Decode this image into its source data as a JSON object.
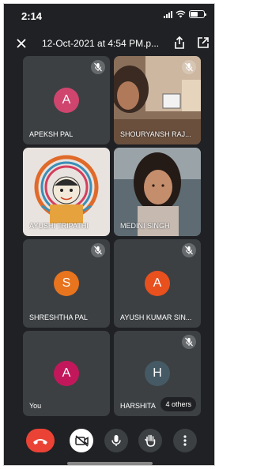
{
  "status_bar": {
    "time": "2:14"
  },
  "header": {
    "title": "12-Oct-2021 at 4:54 PM.p..."
  },
  "participants": [
    {
      "name": "APEKSH PAL",
      "initial": "A",
      "avatar_color": "#d0456e",
      "muted": true,
      "has_video": false
    },
    {
      "name": "SHOURYANSH RAJ...",
      "initial": "",
      "avatar_color": "",
      "muted": true,
      "has_video": true
    },
    {
      "name": "AYUSHI TRIPATHI",
      "initial": "",
      "avatar_color": "",
      "muted": false,
      "has_video": true
    },
    {
      "name": "MEDINI SINGH",
      "initial": "",
      "avatar_color": "",
      "muted": false,
      "has_video": true
    },
    {
      "name": "SHRESHTHA PAL",
      "initial": "S",
      "avatar_color": "#e8741e",
      "muted": true,
      "has_video": false
    },
    {
      "name": "AYUSH KUMAR SIN...",
      "initial": "A",
      "avatar_color": "#e8501e",
      "muted": true,
      "has_video": false
    },
    {
      "name": "You",
      "initial": "A",
      "avatar_color": "#c2185b",
      "muted": false,
      "has_video": false
    },
    {
      "name": "HARSHITA",
      "initial": "H",
      "avatar_color": "#455a64",
      "muted": true,
      "has_video": false
    }
  ],
  "others_chip": "4 others",
  "colors": {
    "end_call": "#ea4335",
    "background": "#202124",
    "tile": "#3c4043"
  }
}
